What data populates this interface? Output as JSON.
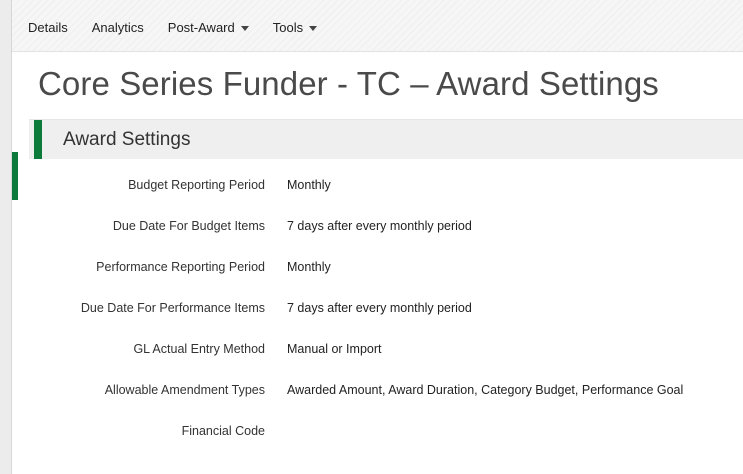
{
  "nav": {
    "items": [
      {
        "label": "Details",
        "has_dropdown": false
      },
      {
        "label": "Analytics",
        "has_dropdown": false
      },
      {
        "label": "Post-Award",
        "has_dropdown": true
      },
      {
        "label": "Tools",
        "has_dropdown": true
      }
    ]
  },
  "page": {
    "title": "Core Series Funder - TC – Award Settings"
  },
  "section": {
    "title": "Award Settings",
    "accent_color": "#0b7a3b"
  },
  "settings": [
    {
      "label": "Budget Reporting Period",
      "value": "Monthly"
    },
    {
      "label": "Due Date For Budget Items",
      "value": "7 days after every monthly period"
    },
    {
      "label": "Performance Reporting Period",
      "value": "Monthly"
    },
    {
      "label": "Due Date For Performance Items",
      "value": "7 days after every monthly period"
    },
    {
      "label": "GL Actual Entry Method",
      "value": "Manual or Import"
    },
    {
      "label": "Allowable Amendment Types",
      "value": "Awarded Amount, Award Duration, Category Budget, Performance Goal"
    },
    {
      "label": "Financial Code",
      "value": ""
    }
  ]
}
